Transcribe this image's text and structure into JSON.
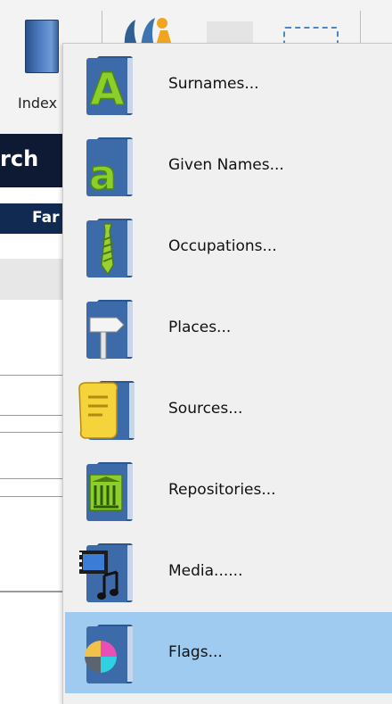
{
  "toolbar": {
    "index_label": "Index"
  },
  "background": {
    "search_fragment": "rch",
    "family_fragment": "Far"
  },
  "menu": {
    "items": [
      {
        "label": "Surnames...",
        "icon": "surnames-icon"
      },
      {
        "label": "Given Names...",
        "icon": "given-names-icon"
      },
      {
        "label": "Occupations...",
        "icon": "occupations-icon"
      },
      {
        "label": "Places...",
        "icon": "places-icon"
      },
      {
        "label": "Sources...",
        "icon": "sources-icon"
      },
      {
        "label": "Repositories...",
        "icon": "repositories-icon"
      },
      {
        "label": "Media......",
        "icon": "media-icon"
      },
      {
        "label": "Flags...",
        "icon": "flags-icon",
        "selected": true
      }
    ]
  },
  "colors": {
    "selection": "#9fcbf1",
    "menu_background": "#f0f0f0",
    "book_blue": "#3d6aa8"
  }
}
